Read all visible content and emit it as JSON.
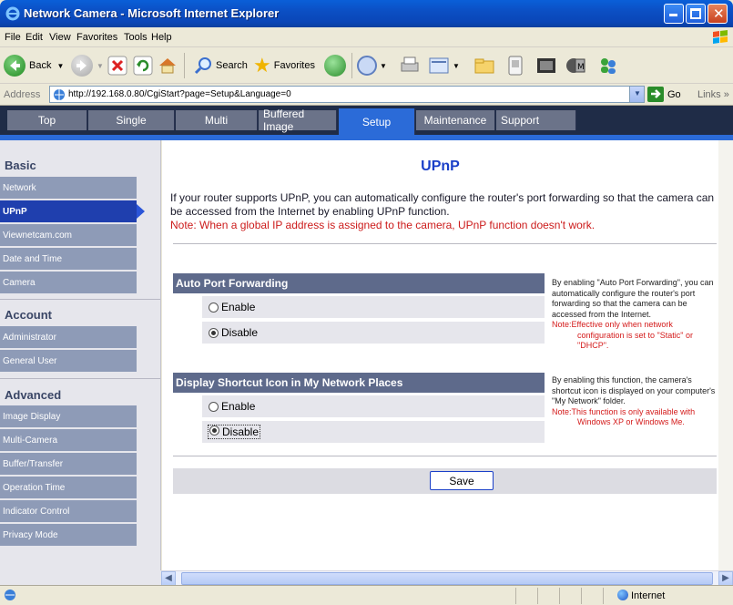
{
  "window": {
    "title": "Network Camera - Microsoft Internet Explorer"
  },
  "menu": [
    "File",
    "Edit",
    "View",
    "Favorites",
    "Tools",
    "Help"
  ],
  "toolbar": {
    "back": "Back",
    "search": "Search",
    "favorites": "Favorites"
  },
  "address": {
    "label": "Address",
    "url": "http://192.168.0.80/CgiStart?page=Setup&Language=0",
    "go": "Go",
    "links": "Links"
  },
  "tabs": [
    "Top",
    "Single",
    "Multi",
    "Buffered Image",
    "Setup",
    "Maintenance",
    "Support"
  ],
  "active_tab": "Setup",
  "sidebar": {
    "basic": {
      "title": "Basic",
      "items": [
        "Network",
        "UPnP",
        "Viewnetcam.com",
        "Date and Time",
        "Camera"
      ]
    },
    "account": {
      "title": "Account",
      "items": [
        "Administrator",
        "General User"
      ]
    },
    "advanced": {
      "title": "Advanced",
      "items": [
        "Image Display",
        "Multi-Camera",
        "Buffer/Transfer",
        "Operation Time",
        "Indicator Control",
        "Privacy Mode"
      ]
    },
    "active_item": "UPnP"
  },
  "main": {
    "title": "UPnP",
    "intro": "If your router supports UPnP, you can automatically configure the router's port forwarding so that the camera can be accessed from the Internet by enabling UPnP function.",
    "note": "Note: When a global IP address is assigned to the camera, UPnP function doesn't work.",
    "sections": [
      {
        "title": "Auto Port Forwarding",
        "options": [
          "Enable",
          "Disable"
        ],
        "selected": "Disable",
        "help": "By enabling \"Auto Port Forwarding\", you can automatically configure the router's port forwarding so that the camera can be accessed from the Internet.",
        "note_prefix": "Note:Effective only when network",
        "note_rest": "configuration is set to \"Static\" or \"DHCP\"."
      },
      {
        "title": "Display Shortcut Icon in My Network Places",
        "options": [
          "Enable",
          "Disable"
        ],
        "selected": "Disable",
        "help": "By enabling this function, the camera's shortcut icon is displayed on your computer's \"My Network\" folder.",
        "note_prefix": "Note:This function is only available with",
        "note_rest": "Windows XP or Windows Me."
      }
    ],
    "save_label": "Save"
  },
  "status": {
    "zone": "Internet"
  },
  "colors": {
    "nav_active": "#2b6bd8",
    "sidebar_active": "#1f3fae",
    "title_blue": "#1a3fc8",
    "note_red": "#cc1b1b"
  }
}
